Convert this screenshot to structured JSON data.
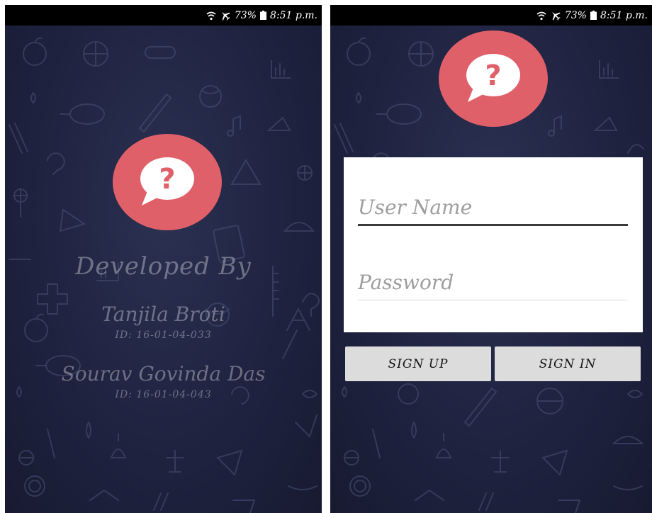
{
  "status_bar": {
    "battery": "73%",
    "time": "8:51 p.m.",
    "icons": [
      "wifi-icon",
      "airplane-icon",
      "battery-icon"
    ]
  },
  "splash": {
    "heading": "Developed By",
    "developers": [
      {
        "name": "Tanjila Broti",
        "id": "ID: 16-01-04-033"
      },
      {
        "name": "Sourav Govinda Das",
        "id": "ID: 16-01-04-043"
      }
    ]
  },
  "login": {
    "username_placeholder": "User Name",
    "password_placeholder": "Password",
    "signup_label": "SIGN UP",
    "signin_label": "SIGN IN"
  },
  "logo": {
    "icon": "question-chat-bubble-icon",
    "glyph": "?"
  },
  "colors": {
    "background": "#1f2340",
    "logo": "#e0606a",
    "button": "#dcdcdc",
    "credit_text": "#8a8d9c"
  }
}
